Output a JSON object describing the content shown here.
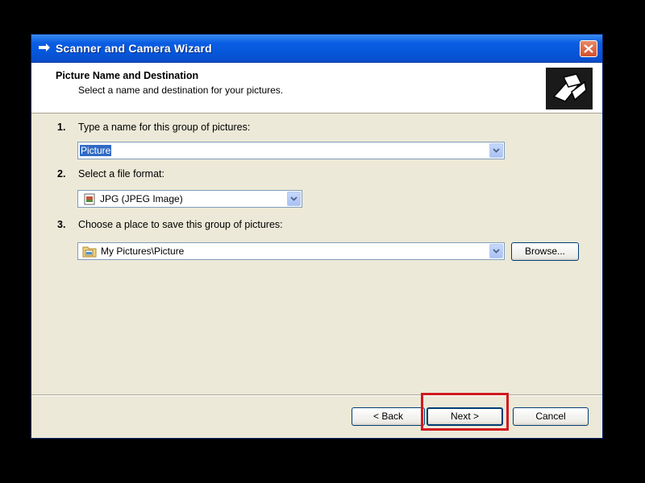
{
  "window": {
    "title": "Scanner and Camera Wizard"
  },
  "header": {
    "title": "Picture Name and Destination",
    "subtitle": "Select a name and destination for your pictures."
  },
  "steps": [
    {
      "number": "1.",
      "label": "Type a name for this group of pictures:"
    },
    {
      "number": "2.",
      "label": "Select a file format:"
    },
    {
      "number": "3.",
      "label": "Choose a place to save this group of pictures:"
    }
  ],
  "fields": {
    "group_name": "Picture",
    "file_format": "JPG (JPEG Image)",
    "save_location": "My Pictures\\Picture"
  },
  "buttons": {
    "browse": "Browse...",
    "back": "< Back",
    "next": "Next >",
    "cancel": "Cancel"
  },
  "icons": {
    "title": "scanner-arrow-icon",
    "header": "wizard-camera-icon",
    "format": "image-file-icon",
    "folder": "folder-icon"
  },
  "colors": {
    "titlebar": "#0556d8",
    "highlight": "#d0191f",
    "selection": "#316ac5"
  }
}
